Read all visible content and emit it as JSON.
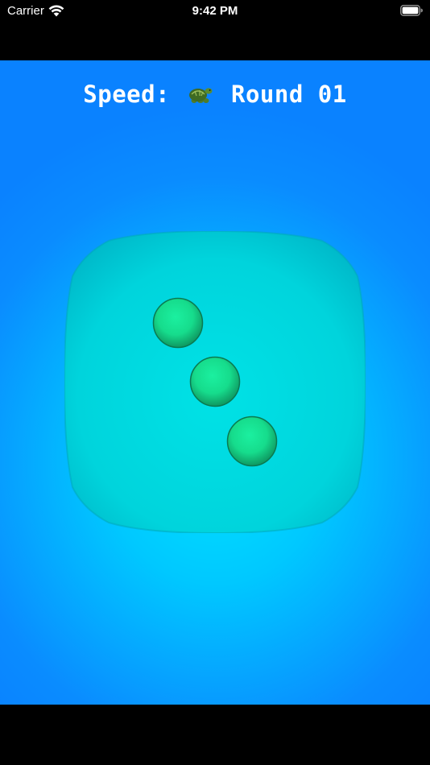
{
  "status_bar": {
    "carrier": "Carrier",
    "time": "9:42 PM",
    "wifi_icon": "wifi-icon",
    "battery_icon": "battery-icon"
  },
  "hud": {
    "speed_label": "Speed:",
    "speed_icon": "turtle-icon",
    "round_label": "Round 01"
  },
  "die": {
    "face_value": 3,
    "face_color": "#00d8df",
    "pip_color": "#18e08e"
  },
  "colors": {
    "background_edge": "#0a82ff",
    "background_center": "#00e4ff"
  }
}
